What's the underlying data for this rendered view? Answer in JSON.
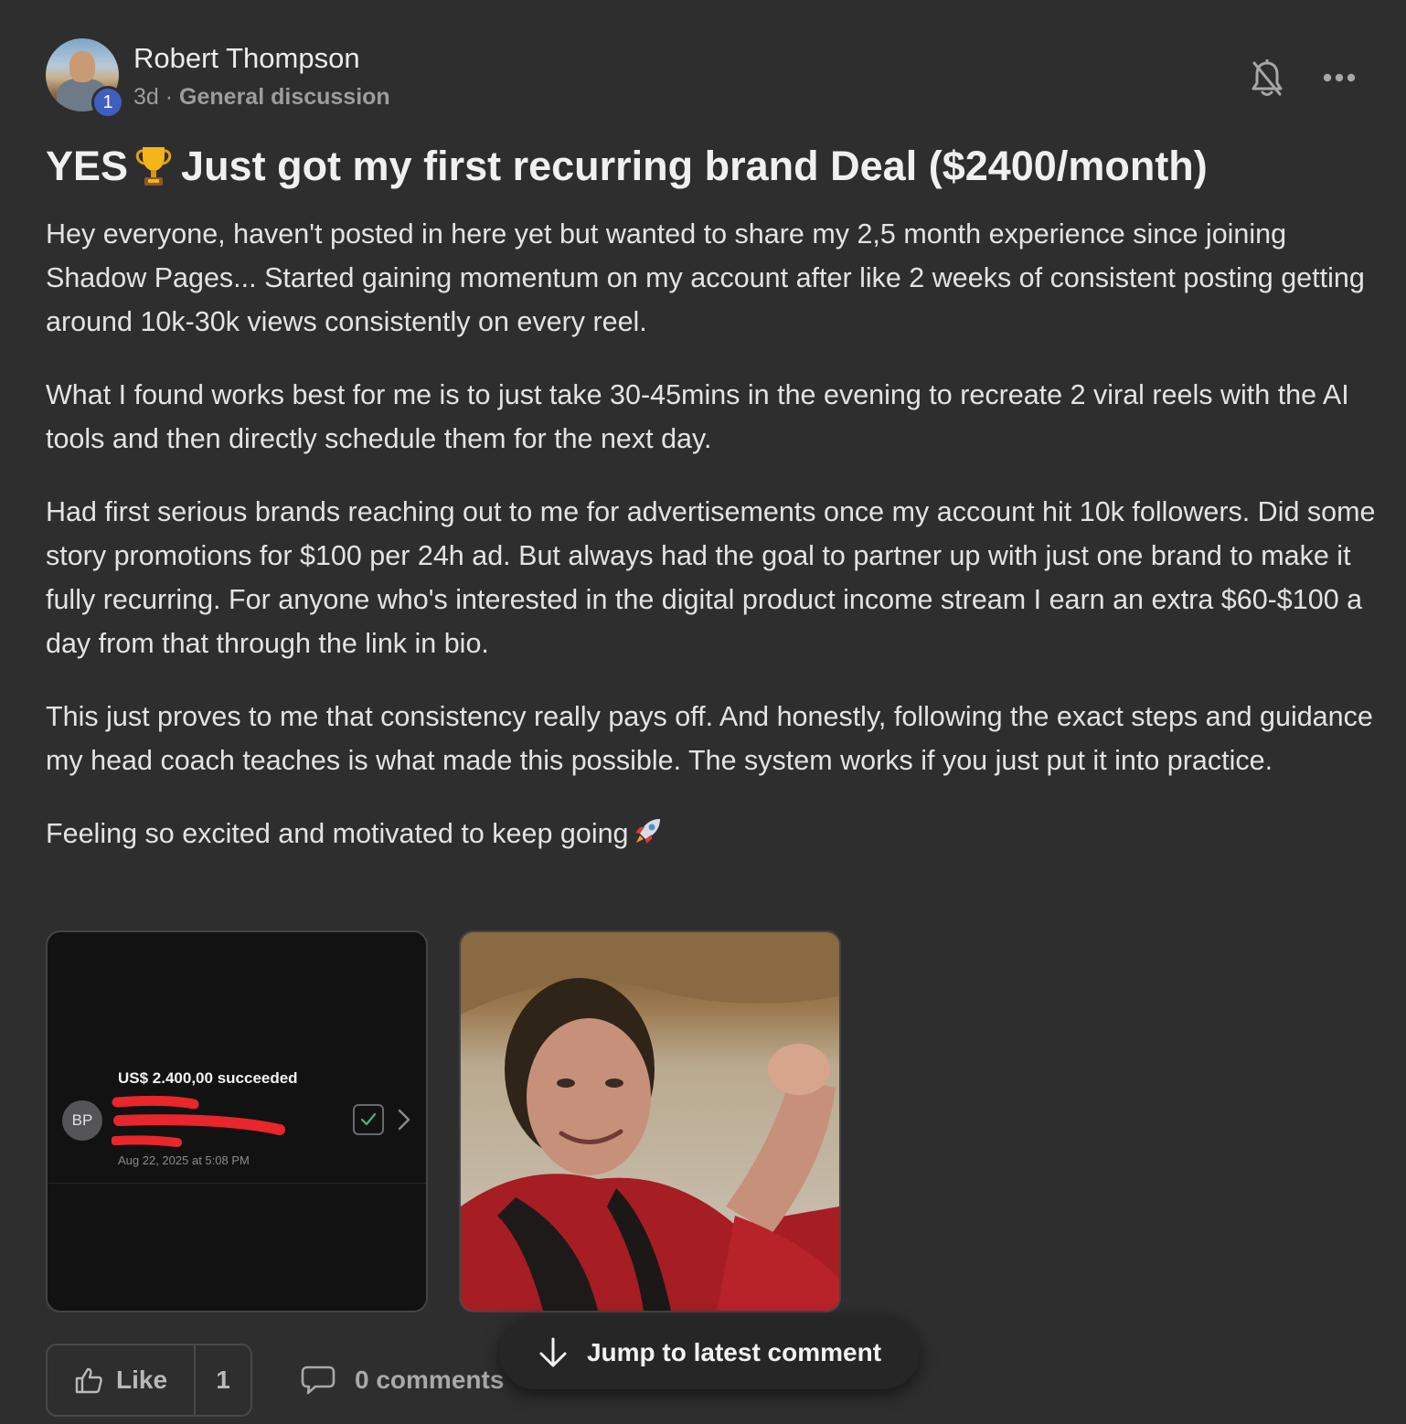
{
  "post": {
    "author": {
      "name": "Robert Thompson",
      "level": "1"
    },
    "time_ago": "3d",
    "separator": "·",
    "category": "General discussion",
    "title_before": "YES",
    "title_after": "Just got my first recurring brand Deal ($2400/month)",
    "paragraphs": [
      "Hey everyone, haven't posted in here yet but wanted to share my 2,5 month experience since joining Shadow Pages... Started gaining momentum on my account after like 2 weeks of consistent posting getting around 10k-30k views consistently on every reel.",
      "What I found works best for me is to just take 30-45mins in the evening to recreate 2 viral reels with the AI tools and then directly schedule them for the next day.",
      "Had first serious brands reaching out to me for advertisements once my account hit 10k followers. Did some story promotions for $100 per 24h ad. But always had the goal to partner up with just one brand to make it fully recurring. For anyone who's interested in the digital product income stream I earn an extra $60-$100 a day from that through the link in bio.",
      "This just proves to me that consistency really pays off. And honestly, following the exact steps and guidance my head coach teaches is what made this possible. The system works if you just put it into practice.",
      "Feeling so excited and motivated to keep going"
    ],
    "attachments": {
      "payment_screenshot": {
        "amount_status": "US$ 2.400,00 succeeded",
        "avatar_initials": "BP",
        "date": "Aug 22, 2025 at 5:08 PM"
      },
      "gif": {
        "icon": "celebration-gif-image"
      }
    },
    "actions": {
      "like_label": "Like",
      "like_count": "1",
      "comments_label": "0 comments",
      "jump_label": "Jump to latest comment"
    }
  },
  "icons": {
    "bell": "bell-off-icon",
    "more": "ellipsis-icon",
    "trophy": "trophy-emoji",
    "rocket": "rocket-emoji",
    "like": "thumbs-up-icon",
    "comment": "comment-bubble-icon",
    "jump": "arrow-down-icon"
  },
  "colors": {
    "background": "#2e2e2f",
    "level_badge": "#3f5fbf",
    "redaction": "#e8262b"
  }
}
